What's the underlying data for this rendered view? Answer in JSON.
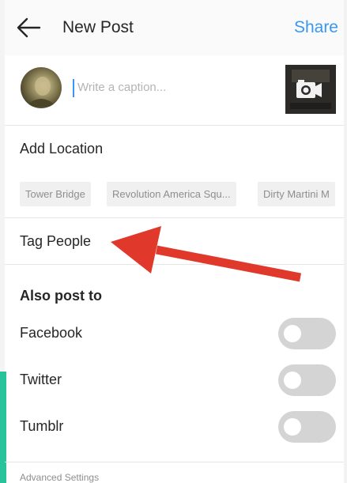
{
  "header": {
    "back_icon": "arrow-left-icon",
    "title": "New Post",
    "share_label": "Share"
  },
  "caption": {
    "placeholder": "Write a caption..."
  },
  "location": {
    "label": "Add Location",
    "suggestions": [
      "Tower Bridge",
      "Revolution America Squ...",
      "Dirty Martini M"
    ]
  },
  "tag_people": {
    "label": "Tag People"
  },
  "also_post": {
    "heading": "Also post to",
    "items": [
      {
        "label": "Facebook",
        "on": false
      },
      {
        "label": "Twitter",
        "on": false
      },
      {
        "label": "Tumblr",
        "on": false
      }
    ]
  },
  "advanced": {
    "label": "Advanced Settings"
  },
  "colors": {
    "accent": "#3897f0",
    "arrow": "#e0382b",
    "toggle_off": "#d4d4d4",
    "side_strip": "#28c39a"
  }
}
